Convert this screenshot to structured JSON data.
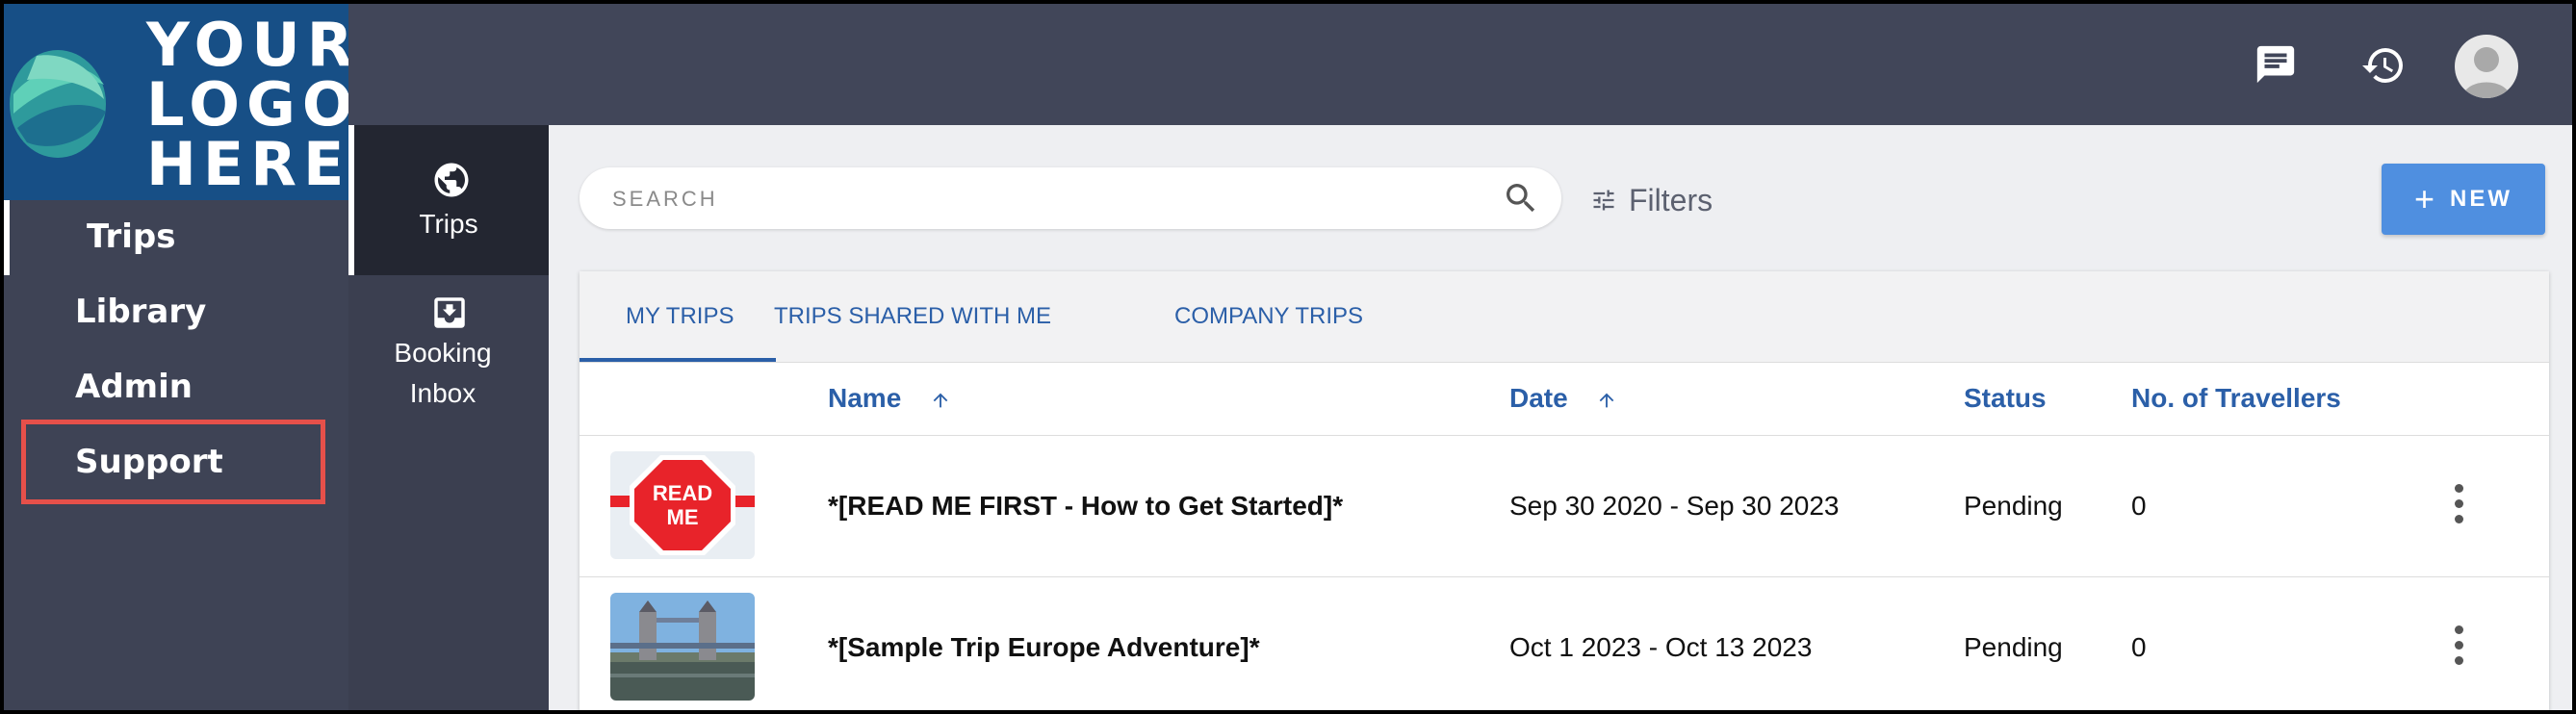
{
  "logo": {
    "lines": [
      "YOUR",
      "LOGO",
      "HERE"
    ]
  },
  "sidebar": {
    "items": [
      {
        "label": "Trips"
      },
      {
        "label": "Library"
      },
      {
        "label": "Admin"
      },
      {
        "label": "Support"
      }
    ],
    "active": "Trips",
    "highlighted": "Support"
  },
  "subnav": {
    "items": [
      {
        "label": "Trips",
        "icon": "globe-icon"
      },
      {
        "label_line1": "Booking",
        "label_line2": "Inbox",
        "icon": "inbox-icon"
      }
    ]
  },
  "topbar": {
    "icons": [
      "chat-icon",
      "history-icon",
      "avatar"
    ]
  },
  "toolbar": {
    "search_placeholder": "SEARCH",
    "filters_label": "Filters",
    "new_label": "NEW"
  },
  "tabs": [
    {
      "label": "MY TRIPS",
      "active": true
    },
    {
      "label": "TRIPS SHARED WITH ME",
      "active": false
    },
    {
      "label": "COMPANY TRIPS",
      "active": false
    }
  ],
  "table": {
    "columns": [
      "Name",
      "Date",
      "Status",
      "No. of Travellers"
    ],
    "rows": [
      {
        "name": "*[READ ME FIRST - How to Get Started]*",
        "date": "Sep 30 2020 - Sep 30 2023",
        "status": "Pending",
        "travellers": "0",
        "thumb_text": "READ ME"
      },
      {
        "name": "*[Sample Trip Europe Adventure]*",
        "date": "Oct 1 2023 - Oct 13 2023",
        "status": "Pending",
        "travellers": "0"
      }
    ]
  },
  "colors": {
    "sidebar": "#3e4355",
    "logo_bg": "#174f86",
    "accent": "#2b5fa8",
    "new_button": "#4f8fe0",
    "highlight_box": "#e6504a"
  }
}
